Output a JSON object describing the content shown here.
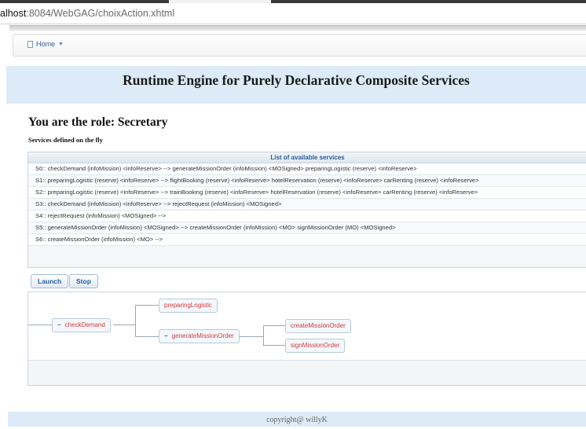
{
  "browser": {
    "url_host": "alhost",
    "url_rest": ":8084/WebGAG/choixAction.xhtml"
  },
  "menubar": {
    "home_label": "Home",
    "home_icon": "page-icon",
    "dropdown_icon": "chevron-down-icon"
  },
  "header": {
    "title": "Runtime Engine for Purely Declarative Composite Services"
  },
  "role_title": "You are the role: Secretary",
  "services_subtitle": "Services defined on the fly",
  "services": {
    "header": "List of available services",
    "rows": [
      "S0:: checkDemand (infoMission) <infoReserve> --> generateMissionOrder (infoMission) <MOSigned> preparingLogistic (reserve) <infoReserve>",
      "S1:: preparingLogistic (reserve) <infoReserve> --> flightBooking (reserve) <infoReserve> hotelReservation (reserve) <infoReserve> carRenting (reserve) <infoReserve>",
      "S2:: preparingLogistic (reserve) <infoReserve> --> trainBooking (reserve) <infoReserve> hotelReservation (reserve) <infoReserve> carRenting (reserve) <infoReserve>",
      "S3:: checkDemand (infoMission) <infoReserve> --> rejectRequest (infoMission) <MOSigned>",
      "S4:: rejectRequest (infoMission) <MOSigned> -->",
      "S5:: generateMissionOrder (infoMission) <MOSigned> --> createMissionOrder (infoMission) <MO> signMissionOrder (MO) <MOSigned>",
      "S6:: createMissionOrder (infoMission) <MO> -->"
    ]
  },
  "buttons": {
    "launch": "Launch",
    "stop": "Stop"
  },
  "tree": {
    "root": {
      "label": "checkDemand",
      "toggle": "−"
    },
    "preparing": {
      "label": "preparingLogistic"
    },
    "generate": {
      "label": "generateMissionOrder",
      "toggle": "−"
    },
    "create": {
      "label": "createMissionOrder"
    },
    "sign": {
      "label": "signMissionOrder"
    }
  },
  "footer": {
    "text": "copyright@ willyK"
  },
  "colors": {
    "header_band": "#dcebf7",
    "node_text": "#d23a3a",
    "link_blue": "#2a5d9a"
  }
}
